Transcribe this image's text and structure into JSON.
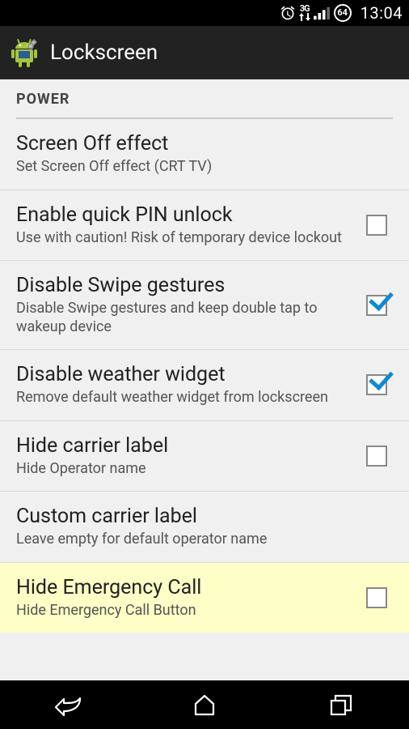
{
  "status_bar": {
    "time": "13:04",
    "battery": "64"
  },
  "app_bar": {
    "title": "Lockscreen"
  },
  "section": {
    "header": "POWER"
  },
  "items": [
    {
      "title": "Screen Off effect",
      "summary": "Set Screen Off effect (CRT TV)",
      "has_checkbox": false,
      "checked": false,
      "highlight": false
    },
    {
      "title": "Enable quick PIN unlock",
      "summary": "Use with caution! Risk of temporary device lockout",
      "has_checkbox": true,
      "checked": false,
      "highlight": false
    },
    {
      "title": "Disable Swipe gestures",
      "summary": "Disable Swipe gestures and keep double tap to wakeup device",
      "has_checkbox": true,
      "checked": true,
      "highlight": false
    },
    {
      "title": "Disable weather widget",
      "summary": "Remove default weather widget from lockscreen",
      "has_checkbox": true,
      "checked": true,
      "highlight": false
    },
    {
      "title": "Hide carrier label",
      "summary": "Hide Operator name",
      "has_checkbox": true,
      "checked": false,
      "highlight": false
    },
    {
      "title": "Custom carrier label",
      "summary": "Leave empty for default operator name",
      "has_checkbox": false,
      "checked": false,
      "highlight": false
    },
    {
      "title": "Hide Emergency Call",
      "summary": "Hide Emergency Call Button",
      "has_checkbox": true,
      "checked": false,
      "highlight": true
    }
  ]
}
